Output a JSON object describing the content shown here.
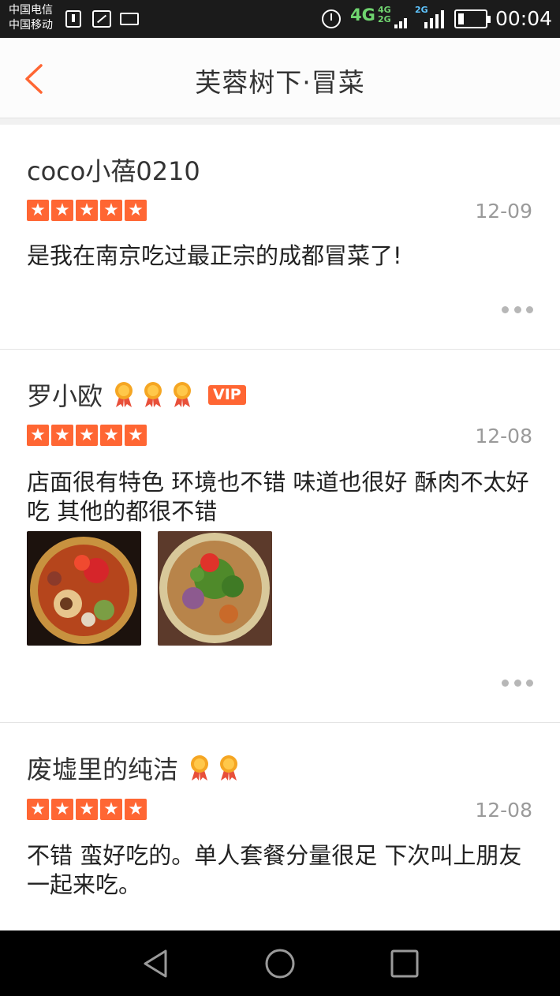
{
  "status_bar": {
    "carrier_1": "中国电信",
    "carrier_2": "中国移动",
    "network_1": "4G",
    "network_2_top": "4G",
    "network_2_bottom": "2G",
    "network_3": "2G",
    "time": "00:04"
  },
  "header": {
    "title": "芙蓉树下·冒菜",
    "back_icon": "chevron-left-icon"
  },
  "reviews": [
    {
      "user": "coco小蓓0210",
      "medals": 0,
      "vip": "",
      "rating": 5,
      "star_glyph": "★",
      "date": "12-09",
      "text": "是我在南京吃过最正宗的成都冒菜了!",
      "photos": 0
    },
    {
      "user": "罗小欧",
      "medals": 3,
      "vip": "VIP",
      "rating": 5,
      "star_glyph": "★",
      "date": "12-08",
      "text": "店面很有特色 环境也不错 味道也很好 酥肉不太好吃 其他的都很不错",
      "photos": 2
    },
    {
      "user": "废墟里的纯洁",
      "medals": 2,
      "vip": "",
      "rating": 5,
      "star_glyph": "★",
      "date": "12-08",
      "text": "不错 蛮好吃的。单人套餐分量很足 下次叫上朋友一起来吃。",
      "photos": 0
    }
  ],
  "colors": {
    "accent": "#ff6633",
    "medal": "#f5a623",
    "status_4g": "#6fd46f",
    "status_2g": "#5fc5ff"
  },
  "system_nav": {
    "back_icon": "triangle-back-icon",
    "home_icon": "circle-home-icon",
    "recents_icon": "square-recents-icon"
  }
}
